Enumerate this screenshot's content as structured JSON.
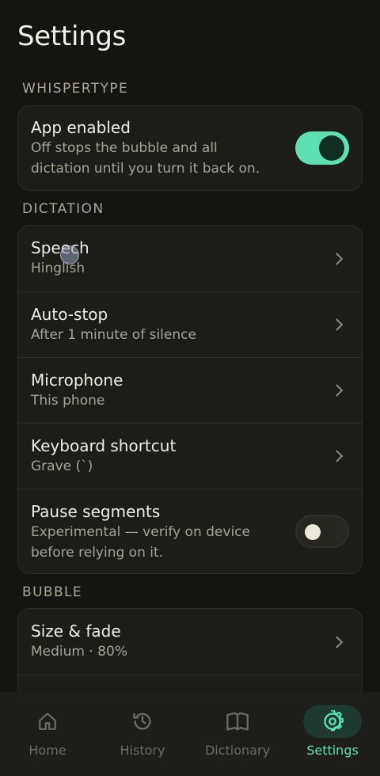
{
  "page": {
    "title": "Settings"
  },
  "sections": {
    "whispertype": {
      "label": "WHISPERTYPE",
      "app_enabled": {
        "title": "App enabled",
        "subtitle_line1": "Off stops the bubble and all",
        "subtitle_line2": "dictation until you turn it back on.",
        "toggle": "on"
      }
    },
    "dictation": {
      "label": "DICTATION",
      "items": [
        {
          "title": "Speech",
          "subtitle": "Hinglish"
        },
        {
          "title": "Auto-stop",
          "subtitle": "After 1 minute of silence"
        },
        {
          "title": "Microphone",
          "subtitle": "This phone"
        },
        {
          "title": "Keyboard shortcut",
          "subtitle": "Grave (`)"
        }
      ],
      "pause_segments": {
        "title": "Pause segments",
        "subtitle_line1": "Experimental — verify on device",
        "subtitle_line2": "before relying on it.",
        "toggle": "off"
      }
    },
    "bubble": {
      "label": "BUBBLE",
      "items": [
        {
          "title": "Size & fade",
          "subtitle": "Medium · 80%"
        }
      ]
    }
  },
  "bottom_nav": {
    "items": [
      {
        "label": "Home",
        "icon": "home-icon"
      },
      {
        "label": "History",
        "icon": "history-icon"
      },
      {
        "label": "Dictionary",
        "icon": "book-icon"
      },
      {
        "label": "Settings",
        "icon": "gear-icon",
        "active": true
      }
    ]
  },
  "colors": {
    "accent": "#5fe0b4",
    "background": "#141411",
    "card": "#1c1c18"
  }
}
